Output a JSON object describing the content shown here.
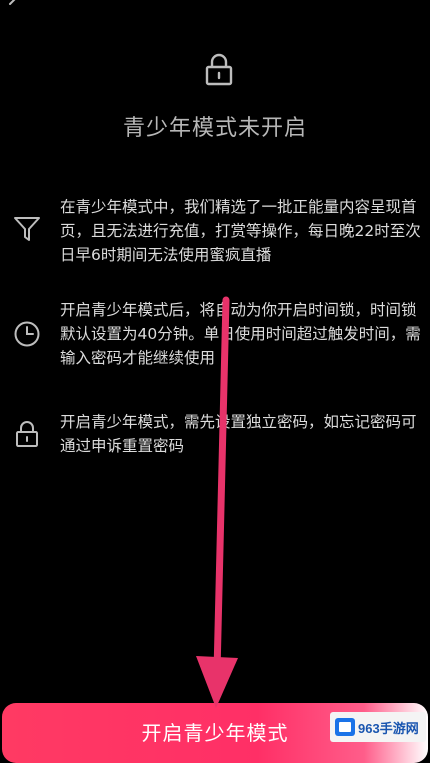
{
  "header": {
    "title": "青少年模式未开启"
  },
  "info_items": [
    {
      "icon": "filter-icon",
      "text": "在青少年模式中，我们精选了一批正能量内容呈现首页，且无法进行充值，打赏等操作，每日晚22时至次日早6时期间无法使用蜜疯直播"
    },
    {
      "icon": "clock-icon",
      "text": "开启青少年模式后，将自动为你开启时间锁，时间锁默认设置为40分钟。单日使用时间超过触发时间，需输入密码才能继续使用"
    },
    {
      "icon": "lock-icon",
      "text": "开启青少年模式，需先设置独立密码，如忘记密码可通过申诉重置密码"
    }
  ],
  "footer": {
    "button_label": "开启青少年模式"
  },
  "watermark": {
    "text": "963手游网"
  },
  "colors": {
    "background": "#000000",
    "accent": "#ff3a63",
    "arrow": "#e8336a"
  }
}
